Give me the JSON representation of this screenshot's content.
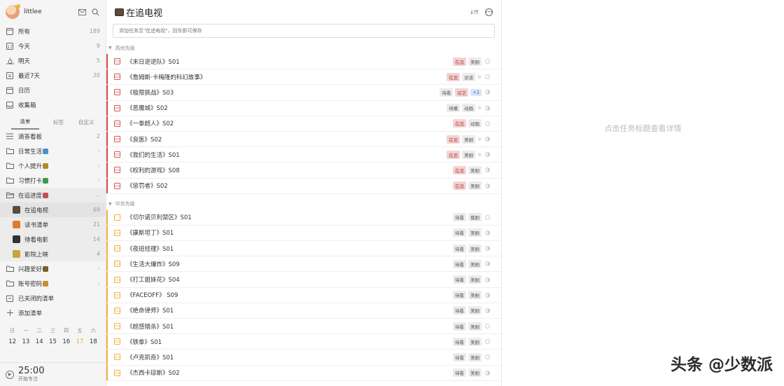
{
  "user": {
    "name": "littlee"
  },
  "smart_lists": [
    {
      "label": "所有",
      "count": "189",
      "icon": "all-icon"
    },
    {
      "label": "今天",
      "count": "9",
      "icon": "today-icon"
    },
    {
      "label": "明天",
      "count": "5",
      "icon": "tomorrow-icon"
    },
    {
      "label": "最近7天",
      "count": "20",
      "icon": "week-icon"
    },
    {
      "label": "日历",
      "count": "",
      "icon": "calendar-icon"
    },
    {
      "label": "收集箱",
      "count": "",
      "icon": "inbox-icon"
    }
  ],
  "tabs": [
    "清单",
    "标签",
    "自定义"
  ],
  "lists": [
    {
      "label": "滴答看板",
      "count": "2",
      "type": "board"
    },
    {
      "label": "日常生活",
      "count": "",
      "type": "folder"
    },
    {
      "label": "个人提升",
      "count": "",
      "type": "folder"
    },
    {
      "label": "习惯打卡",
      "count": "",
      "type": "folder"
    },
    {
      "label": "在追进度",
      "count": "",
      "type": "folder-open"
    }
  ],
  "sub_lists": [
    {
      "label": "在追电视",
      "count": "69",
      "active": true
    },
    {
      "label": "读书清单",
      "count": "21"
    },
    {
      "label": "待看电影",
      "count": "14"
    },
    {
      "label": "影院上映",
      "count": "4"
    }
  ],
  "lists2": [
    {
      "label": "兴趣爱好",
      "count": ""
    },
    {
      "label": "账号密码",
      "count": ""
    },
    {
      "label": "已关闭的清单",
      "count": ""
    },
    {
      "label": "添加清单",
      "count": ""
    }
  ],
  "calendar": {
    "weekdays": [
      "日",
      "一",
      "二",
      "三",
      "四",
      "五",
      "六"
    ],
    "days": [
      "12",
      "13",
      "14",
      "15",
      "16",
      "17",
      "18"
    ],
    "today_index": 5
  },
  "pomo": {
    "time": "25:00",
    "label": "开始专注"
  },
  "main": {
    "title": "在追电视",
    "sort_label": "↓!!!",
    "add_placeholder": "添加任务至\"在追电视\"，回车即可保存",
    "section_high": "高优先级",
    "section_mid": "中优先级"
  },
  "tasks_high": [
    {
      "title": "《末日逆逆队》S01",
      "tags": [
        [
          "在追",
          "red"
        ],
        [
          "美剧",
          "grey"
        ]
      ],
      "link": false,
      "prog": ""
    },
    {
      "title": "《詹姆斯·卡梅隆的科幻故事》",
      "tags": [
        [
          "在追",
          "red"
        ],
        [
          "访谈",
          "grey"
        ]
      ],
      "link": true,
      "prog": ""
    },
    {
      "title": "《极限挑战》S03",
      "tags": [
        [
          "待看",
          "grey"
        ],
        [
          "综艺",
          "red"
        ],
        [
          "+1",
          "blue"
        ]
      ],
      "link": false,
      "prog": "half"
    },
    {
      "title": "《恶魔城》S02",
      "tags": [
        [
          "待播",
          "grey"
        ],
        [
          "动画",
          "grey"
        ]
      ],
      "link": true,
      "prog": "half"
    },
    {
      "title": "《一拳超人》S02",
      "tags": [
        [
          "在追",
          "red"
        ],
        [
          "动画",
          "grey"
        ]
      ],
      "link": false,
      "prog": ""
    },
    {
      "title": "《良医》S02",
      "tags": [
        [
          "在追",
          "red"
        ],
        [
          "美剧",
          "grey"
        ]
      ],
      "link": true,
      "prog": "half"
    },
    {
      "title": "《我们的生活》S01",
      "tags": [
        [
          "在追",
          "red"
        ],
        [
          "美剧",
          "grey"
        ]
      ],
      "link": true,
      "prog": "half"
    },
    {
      "title": "《权利的游戏》S08",
      "tags": [
        [
          "在追",
          "red"
        ],
        [
          "美剧",
          "grey"
        ]
      ],
      "link": false,
      "prog": "half"
    },
    {
      "title": "《惩罚者》S02",
      "tags": [
        [
          "在追",
          "red"
        ],
        [
          "美剧",
          "grey"
        ]
      ],
      "link": false,
      "prog": "half"
    }
  ],
  "tasks_mid": [
    {
      "title": "《切尔诺贝利禁区》S01",
      "tags": [
        [
          "待看",
          "grey"
        ],
        [
          "俄剧",
          "grey"
        ]
      ],
      "link": false,
      "prog": "",
      "empty": true
    },
    {
      "title": "《康斯坦丁》S01",
      "tags": [
        [
          "待看",
          "grey"
        ],
        [
          "美剧",
          "grey"
        ]
      ],
      "link": false,
      "prog": "half"
    },
    {
      "title": "《夜班经理》S01",
      "tags": [
        [
          "待看",
          "grey"
        ],
        [
          "美剧",
          "grey"
        ]
      ],
      "link": false,
      "prog": "half"
    },
    {
      "title": "《生活大爆炸》S09",
      "tags": [
        [
          "待看",
          "grey"
        ],
        [
          "美剧",
          "grey"
        ]
      ],
      "link": false,
      "prog": "half"
    },
    {
      "title": "《打工姐妹花》S04",
      "tags": [
        [
          "待看",
          "grey"
        ],
        [
          "美剧",
          "grey"
        ]
      ],
      "link": false,
      "prog": "half"
    },
    {
      "title": "《FACEOFF》 S09",
      "tags": [
        [
          "待看",
          "grey"
        ],
        [
          "美剧",
          "grey"
        ]
      ],
      "link": false,
      "prog": "half"
    },
    {
      "title": "《绝命律师》S01",
      "tags": [
        [
          "待看",
          "grey"
        ],
        [
          "美剧",
          "grey"
        ]
      ],
      "link": false,
      "prog": "half"
    },
    {
      "title": "《超感猎杀》S01",
      "tags": [
        [
          "待看",
          "grey"
        ],
        [
          "美剧",
          "grey"
        ]
      ],
      "link": false,
      "prog": ""
    },
    {
      "title": "《铁拳》S01",
      "tags": [
        [
          "待看",
          "grey"
        ],
        [
          "美剧",
          "grey"
        ]
      ],
      "link": false,
      "prog": ""
    },
    {
      "title": "《卢克凯奇》S01",
      "tags": [
        [
          "待看",
          "grey"
        ],
        [
          "美剧",
          "grey"
        ]
      ],
      "link": false,
      "prog": ""
    },
    {
      "title": "《杰西卡琼斯》S02",
      "tags": [
        [
          "待看",
          "grey"
        ],
        [
          "美剧",
          "grey"
        ]
      ],
      "link": false,
      "prog": "half"
    }
  ],
  "detail": {
    "placeholder": "点击任务标题查看详情"
  },
  "watermark": "头条 @少数派"
}
